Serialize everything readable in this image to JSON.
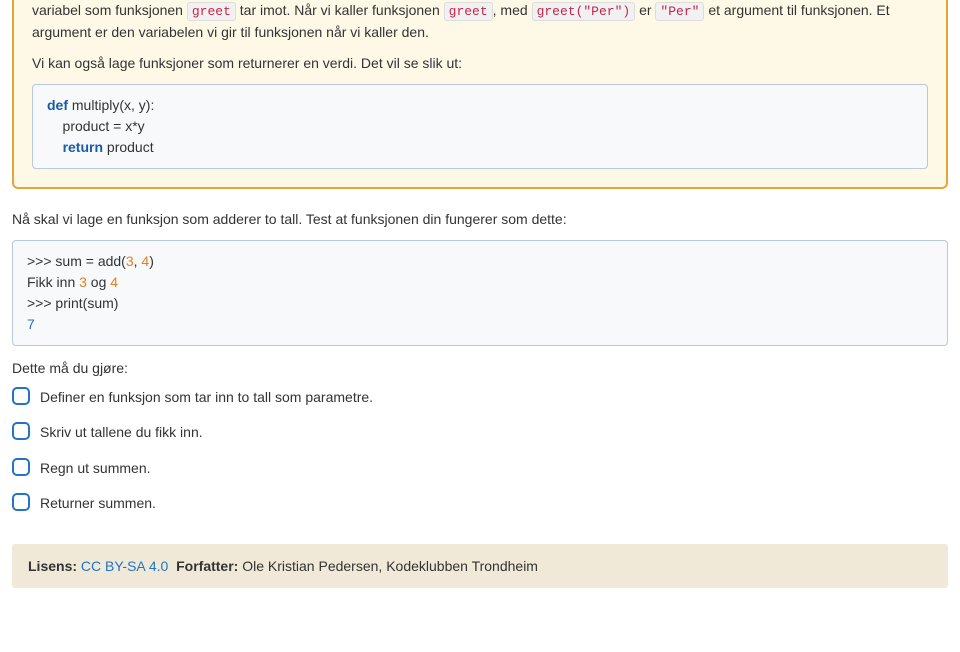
{
  "intro": {
    "p1_pre": "variabel som funksjonen ",
    "p1_code1": "greet",
    "p1_mid1": " tar imot. Når vi kaller funksjonen ",
    "p1_code2": "greet",
    "p1_mid2": ", med ",
    "p1_code3": "greet(\"Per\")",
    "p1_mid3": " er ",
    "p1_code4": "\"Per\"",
    "p1_mid4": " et argument til funksjonen. Et argument er den variabelen vi gir til funksjonen når vi kaller den.",
    "p2": "Vi kan også lage funksjoner som returnerer en verdi. Det vil se slik ut:"
  },
  "code1": {
    "kw1": "def",
    "l1_rest": " multiply(x, y):",
    "l2": "    product = x*y",
    "kw2": "return",
    "l3_rest": " product",
    "l3_indent": "    "
  },
  "task_intro": "Nå skal vi lage en funksjon som adderer to tall. Test at funksjonen din fungerer som dette:",
  "code2": {
    "l1_pre": ">>> sum = add(",
    "n1": "3",
    "l1_mid": ", ",
    "n2": "4",
    "l1_post": ")",
    "l2_pre": "Fikk inn ",
    "l2_n1": "3",
    "l2_mid": " og ",
    "l2_n2": "4",
    "l3": ">>> print(sum)",
    "l4": "7"
  },
  "todo_label": "Dette må du gjøre:",
  "checklist": [
    "Definer en funksjon som tar inn to tall som parametre.",
    "Skriv ut tallene du fikk inn.",
    "Regn ut summen.",
    "Returner summen."
  ],
  "footer": {
    "license_label": "Lisens:",
    "license_value": "CC BY-SA 4.0",
    "author_label": "Forfatter:",
    "author_value": "Ole Kristian Pedersen, Kodeklubben Trondheim"
  }
}
